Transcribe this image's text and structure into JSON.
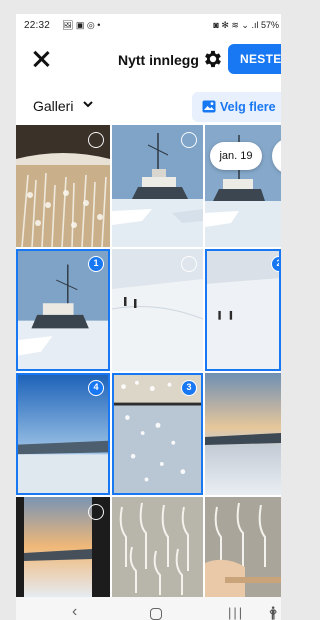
{
  "status_bar": {
    "time": "22:32",
    "left_icons": "🖼 ▣ ◎ •",
    "right_icons": "◙ ✻ ≋ ⌄ .ıl",
    "battery": "57%"
  },
  "header": {
    "title": "Nytt innlegg",
    "next_label": "NESTE"
  },
  "gallery": {
    "selector_label": "Galleri",
    "more_label": "Velg flere"
  },
  "date_chip": "jan. 19",
  "tiles": [
    {
      "subject": "frosted-plants",
      "state": "unselected"
    },
    {
      "subject": "ship-in-ice",
      "state": "unselected"
    },
    {
      "subject": "ship-in-ice",
      "state": "unselected"
    },
    {
      "subject": "ship-in-ice",
      "state": "selected",
      "order": "1"
    },
    {
      "subject": "people-on-ice",
      "state": "unselected"
    },
    {
      "subject": "people-on-ice",
      "state": "selected",
      "order": "2"
    },
    {
      "subject": "frozen-fjord-sunset",
      "state": "selected",
      "order": "4"
    },
    {
      "subject": "frosted-window",
      "state": "selected",
      "order": "3"
    },
    {
      "subject": "fjord-sunset",
      "state": "unselected"
    },
    {
      "subject": "window-sunset",
      "state": "unselected"
    },
    {
      "subject": "wine-glasses",
      "state": "unselected"
    },
    {
      "subject": "wine-glasses",
      "state": "unselected"
    }
  ],
  "nav": {
    "back": "‹",
    "recent": "|||",
    "accessibility": "🛉"
  },
  "colors": {
    "accent": "#1877f2",
    "accent_soft": "#e7f0fc"
  }
}
